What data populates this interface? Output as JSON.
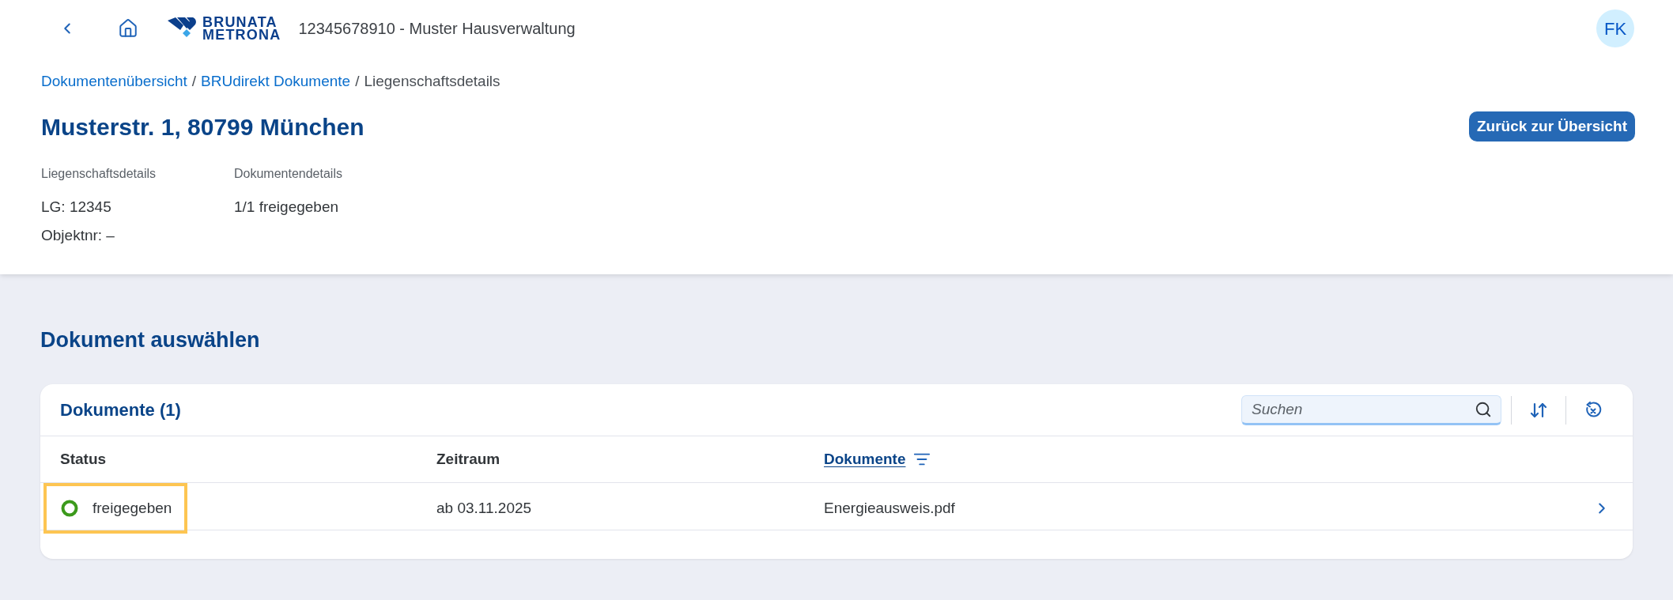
{
  "header": {
    "logo": [
      "BRUNATA",
      "METRONA"
    ],
    "title": "12345678910 - Muster Hausverwaltung",
    "avatar": "FK"
  },
  "breadcrumbs": {
    "separator": "/",
    "items": [
      {
        "label": "Dokumentenübersicht",
        "kind": "link"
      },
      {
        "label": "BRUdirekt Dokumente",
        "kind": "link"
      },
      {
        "label": "Liegenschaftsdetails",
        "kind": "current"
      }
    ]
  },
  "page_title": "Musterstr. 1, 80799 München",
  "back_button": "Zurück zur Übersicht",
  "details": [
    {
      "label": "Liegenschaftsdetails",
      "values": [
        "LG: 12345",
        "Objektnr: –"
      ]
    },
    {
      "label": "Dokumentendetails",
      "values": [
        "1/1 freigegeben"
      ]
    }
  ],
  "section_title": "Dokument auswählen",
  "table": {
    "title": "Dokumente (1)",
    "search": {
      "placeholder": "Suchen"
    },
    "columns": [
      {
        "label": "Status",
        "filtered": false
      },
      {
        "label": "Zeitraum",
        "filtered": false
      },
      {
        "label": "Dokumente",
        "filtered": true
      }
    ],
    "rows": [
      {
        "status": {
          "label": "freigegeben",
          "color": "#3c9a1c",
          "highlighted": true
        },
        "period": "ab 03.11.2025",
        "document": "Energieausweis.pdf"
      }
    ]
  }
}
